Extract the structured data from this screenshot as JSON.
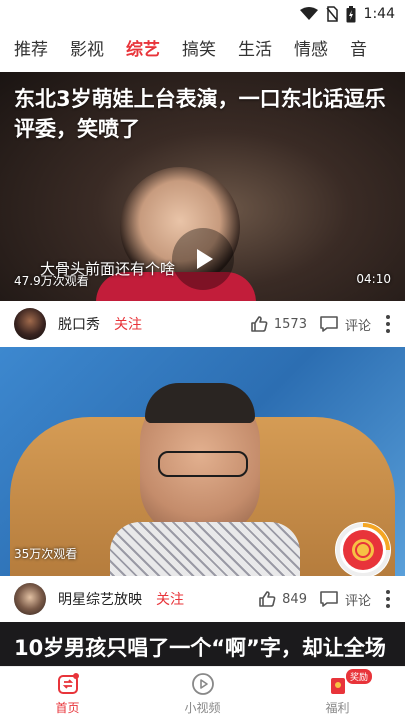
{
  "status": {
    "time": "1:44"
  },
  "tabs": [
    {
      "label": "推荐"
    },
    {
      "label": "影视"
    },
    {
      "label": "综艺"
    },
    {
      "label": "搞笑"
    },
    {
      "label": "生活"
    },
    {
      "label": "情感"
    },
    {
      "label": "音"
    }
  ],
  "active_tab": "综艺",
  "cards": [
    {
      "title": "东北3岁萌娃上台表演，一口东北话逗乐评委，笑喷了",
      "subtitle": "大骨头前面还有个啥",
      "views": "47.9万次观看",
      "duration": "04:10",
      "channel": "脱口秀",
      "follow": "关注",
      "likes": "1573",
      "comment": "评论"
    },
    {
      "views": "35万次观看",
      "channel": "明星综艺放映",
      "follow": "关注",
      "likes": "849",
      "comment": "评论"
    },
    {
      "title": "10岁男孩只唱了一个“啊”字，却让全场"
    }
  ],
  "bottom_nav": [
    {
      "label": "首页",
      "icon": "home-icon"
    },
    {
      "label": "小视频",
      "icon": "play-circle-icon"
    },
    {
      "label": "福利",
      "icon": "gift-icon",
      "badge": "奖励"
    }
  ],
  "colors": {
    "accent": "#e8343a"
  }
}
